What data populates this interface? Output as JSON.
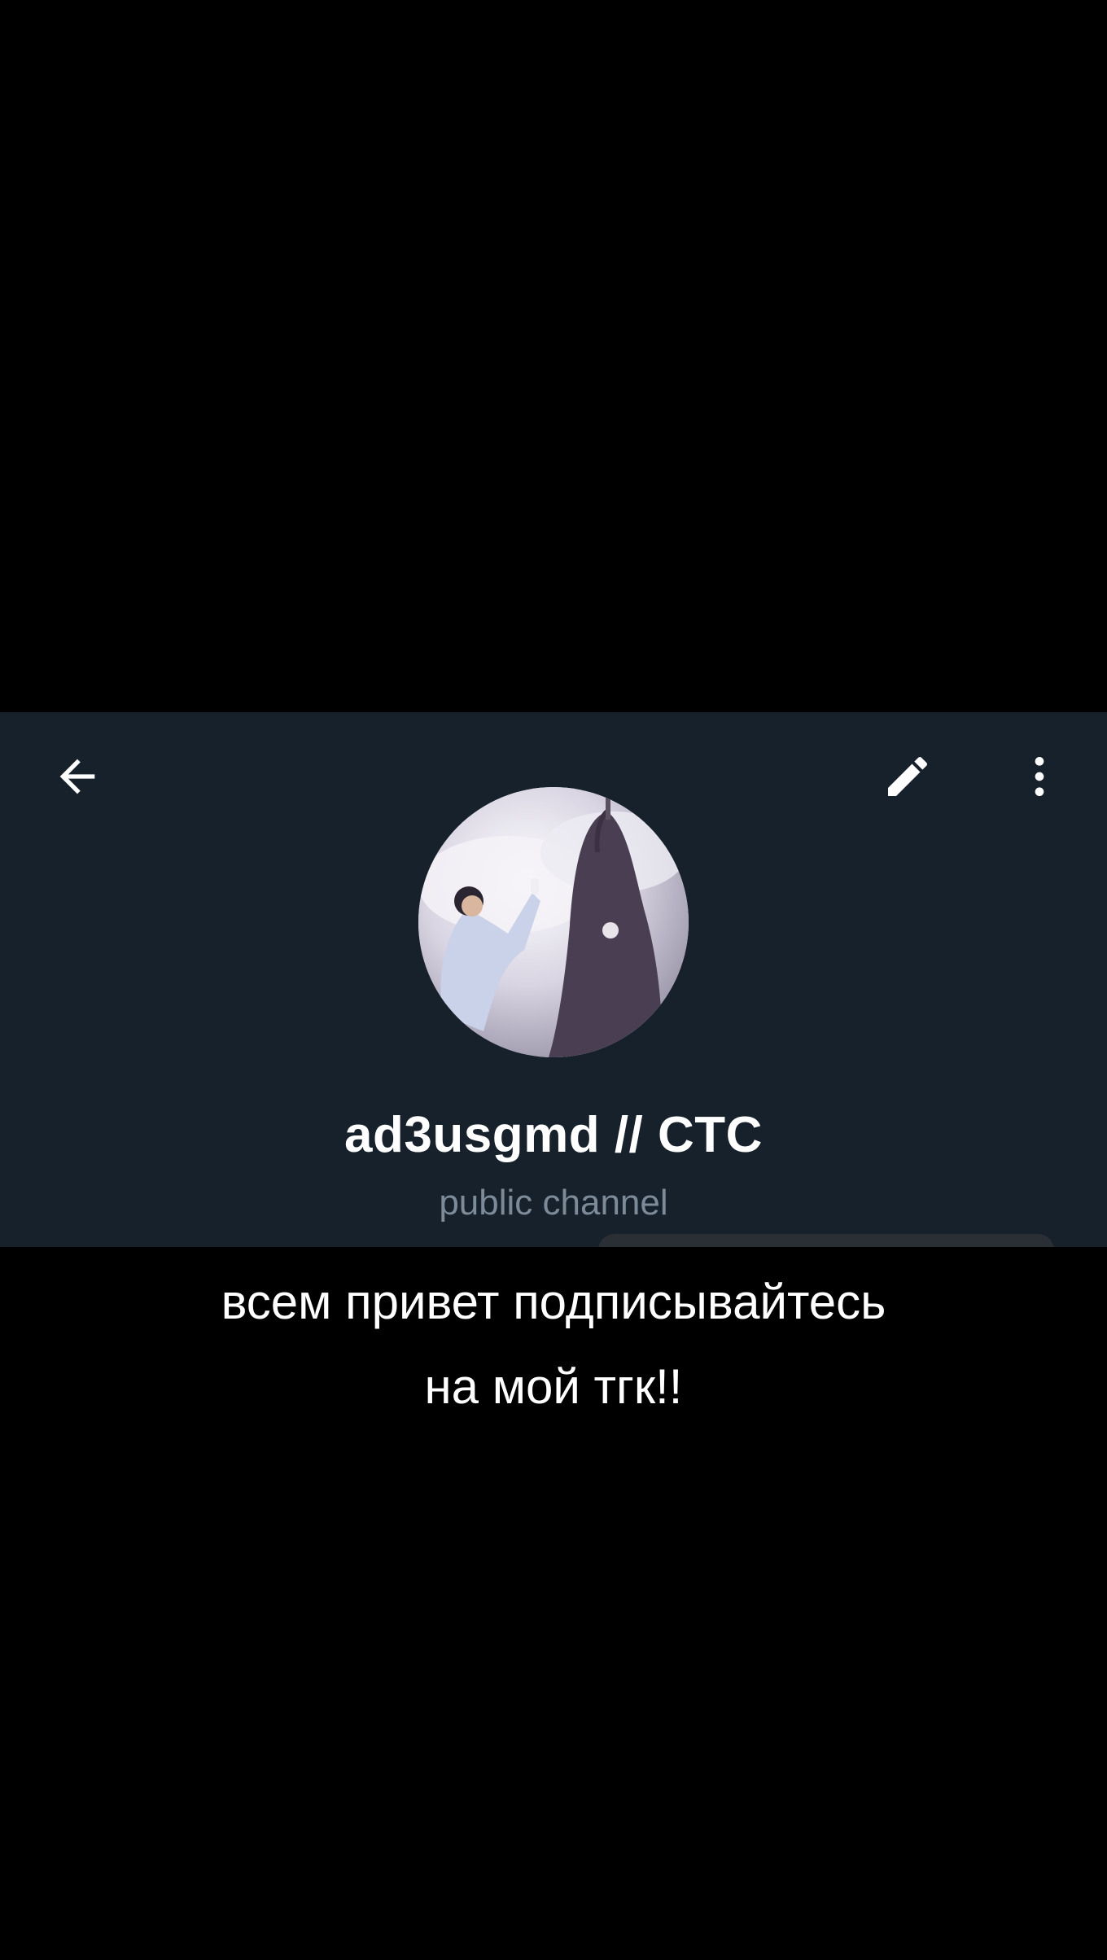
{
  "header": {
    "back_icon": "arrow-left-icon",
    "edit_icon": "pencil-icon",
    "menu_icon": "more-vertical-icon"
  },
  "profile": {
    "title": "ad3usgmd // CTC",
    "subtitle": "public channel",
    "avatar_description_icon": "avatar-image"
  },
  "caption": {
    "line1": "всем привет подписывайтесь",
    "line2": "на мой тгк!!"
  },
  "colors": {
    "panel_bg": "#17212b",
    "subtitle": "#7d8b99",
    "background": "#000000",
    "text": "#ffffff"
  }
}
